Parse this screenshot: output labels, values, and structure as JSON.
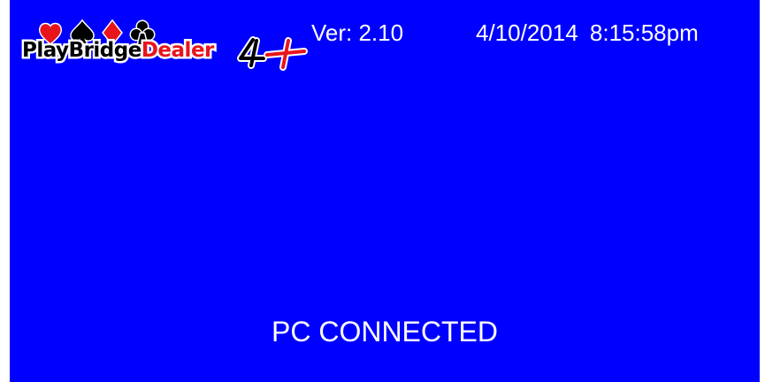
{
  "header": {
    "logo": {
      "part_play_bridge": "PlayBridge",
      "part_dealer": "Dealer",
      "part_suffix": "4+",
      "suit_icons": [
        "heart-icon",
        "spade-icon",
        "diamond-icon",
        "club-icon"
      ]
    },
    "version_label": "Ver: 2.10",
    "datetime": "4/10/2014  8:15:58pm"
  },
  "status_text": "PC CONNECTED",
  "colors": {
    "background": "#0000ff",
    "text": "#ffffff",
    "logo_red": "#e8141c",
    "logo_black": "#000000"
  }
}
